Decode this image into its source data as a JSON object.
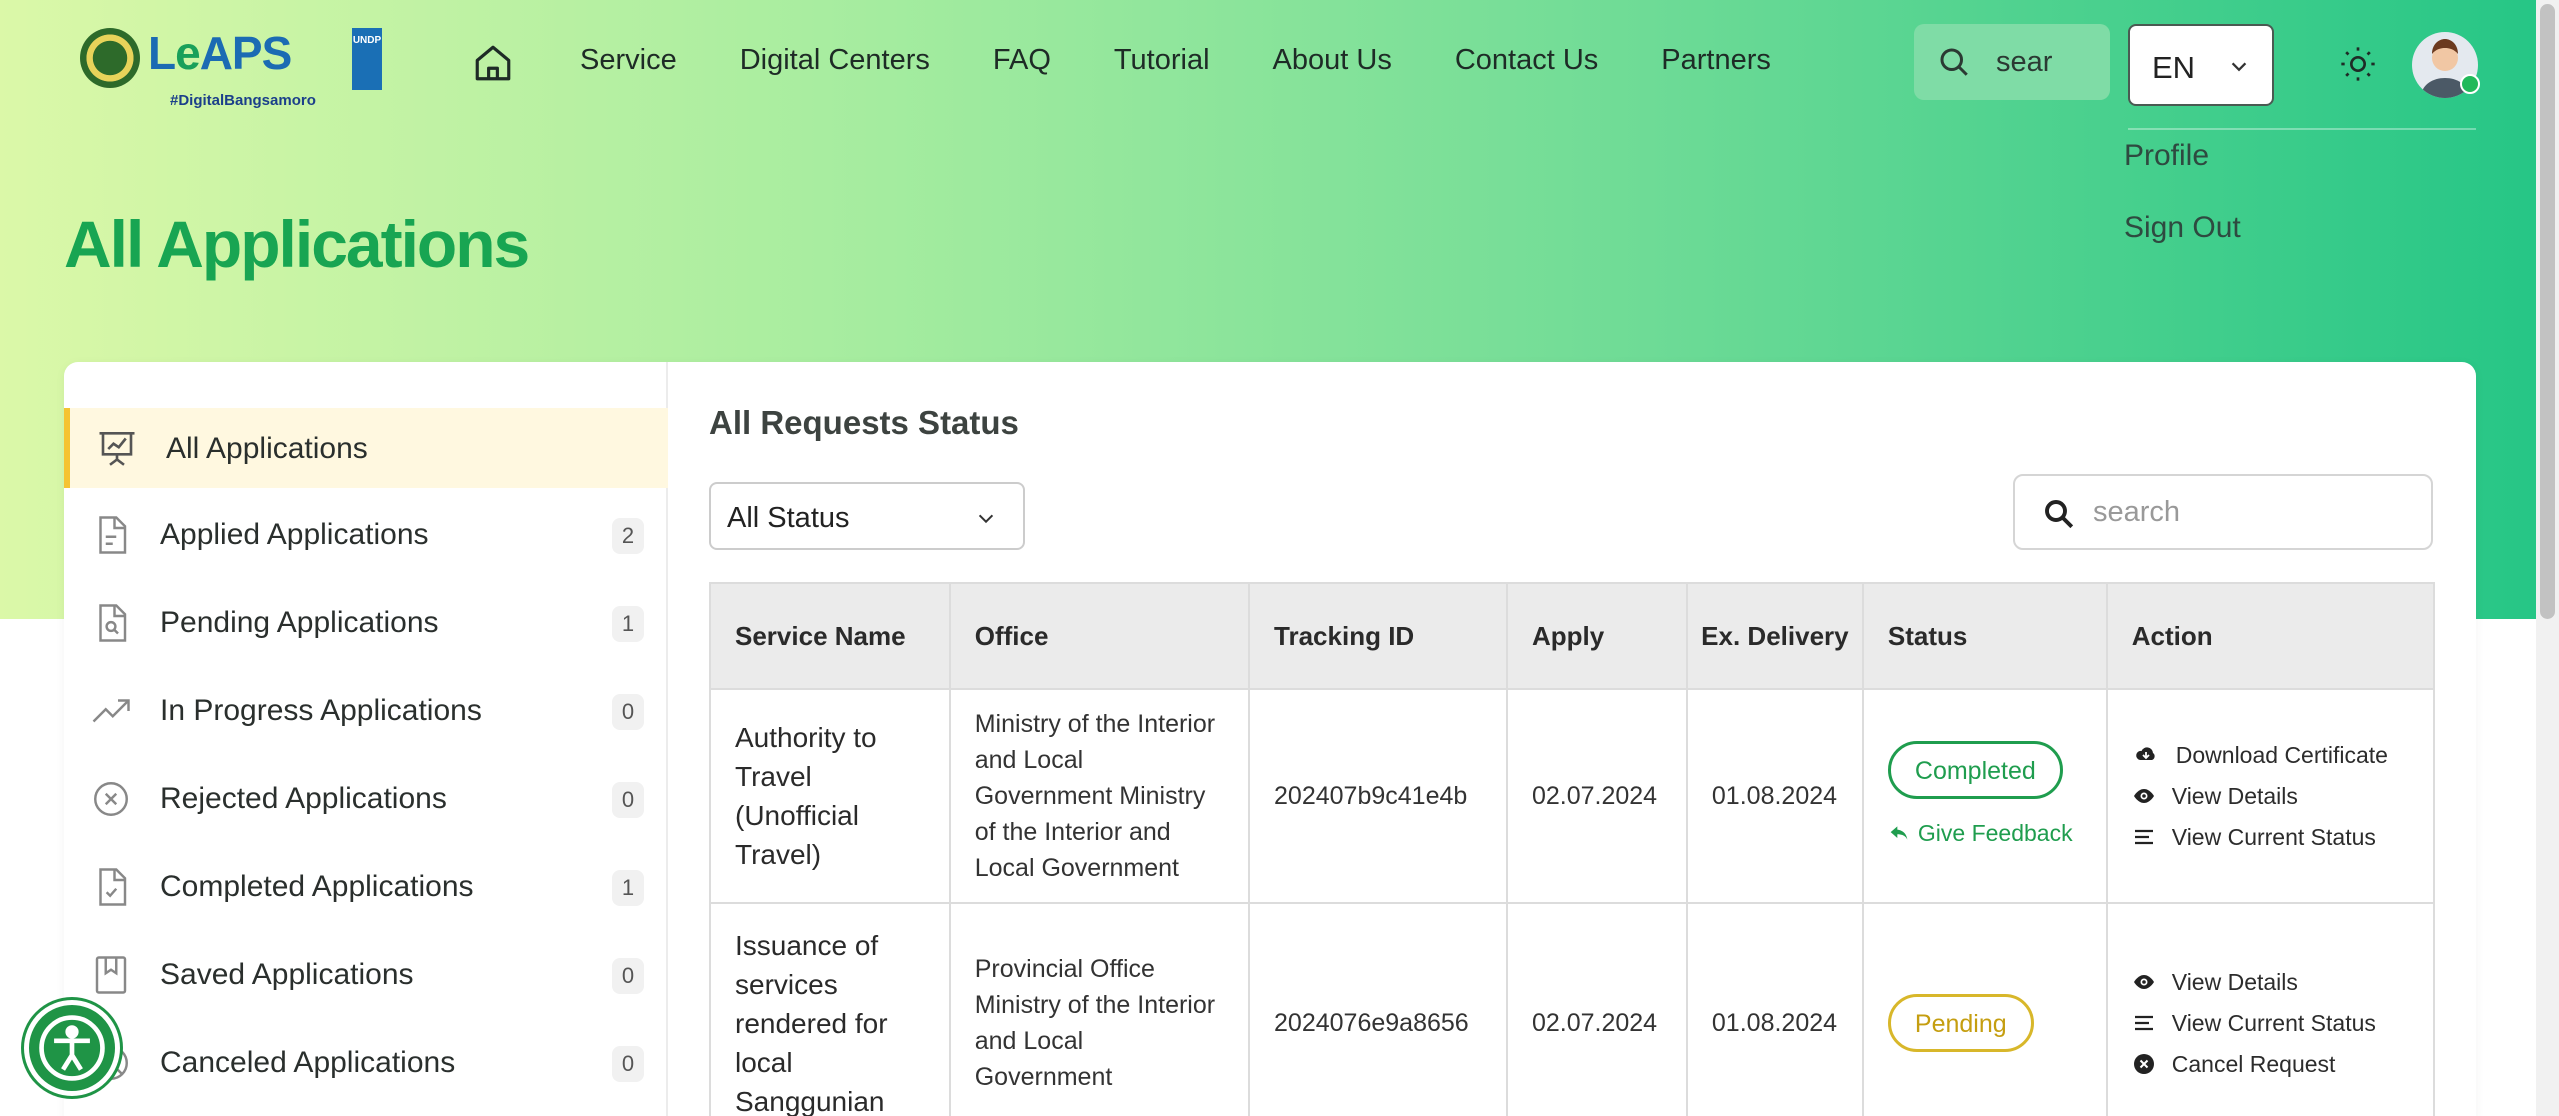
{
  "header": {
    "logo": {
      "brand_pre": "L",
      "brand_mid": "e",
      "brand_post": "APS",
      "tagline": "#DigitalBangsamoro",
      "undp": "UNDP"
    },
    "nav": [
      "Service",
      "Digital Centers",
      "FAQ",
      "Tutorial",
      "About Us",
      "Contact Us",
      "Partners"
    ],
    "search_placeholder": "sear",
    "language": "EN"
  },
  "user_menu": [
    "Profile",
    "Sign Out"
  ],
  "page_title": "All Applications",
  "sidebar": [
    {
      "label": "All Applications",
      "count": "",
      "icon": "presentation-chart-icon"
    },
    {
      "label": "Applied Applications",
      "count": "2",
      "icon": "document-icon"
    },
    {
      "label": "Pending Applications",
      "count": "1",
      "icon": "document-search-icon"
    },
    {
      "label": "In Progress Applications",
      "count": "0",
      "icon": "trending-up-icon"
    },
    {
      "label": "Rejected Applications",
      "count": "0",
      "icon": "x-circle-icon"
    },
    {
      "label": "Completed Applications",
      "count": "1",
      "icon": "document-check-icon"
    },
    {
      "label": "Saved Applications",
      "count": "0",
      "icon": "bookmark-icon"
    },
    {
      "label": "Canceled Applications",
      "count": "0",
      "icon": "cancel-icon"
    }
  ],
  "main": {
    "title": "All Requests Status",
    "status_filter": "All Status",
    "search_placeholder": "search",
    "columns": [
      "Service Name",
      "Office",
      "Tracking ID",
      "Apply",
      "Ex. Delivery",
      "Status",
      "Action"
    ],
    "rows": [
      {
        "service": "Authority to Travel (Unofficial Travel)",
        "office": "Ministry of the Interior and Local Government Ministry of the Interior and Local Government",
        "tracking_id": "202407b9c41e4b",
        "apply": "02.07.2024",
        "delivery": "01.08.2024",
        "status": "Completed",
        "feedback": "Give Feedback",
        "actions": [
          "Download Certificate",
          "View Details",
          "View Current Status"
        ]
      },
      {
        "service": "Issuance of services rendered for local Sanggunian",
        "office": "Provincial Office Ministry of the Interior and Local Government",
        "tracking_id": "2024076e9a8656",
        "apply": "02.07.2024",
        "delivery": "01.08.2024",
        "status": "Pending",
        "feedback": "",
        "actions": [
          "View Details",
          "View Current Status",
          "Cancel Request"
        ]
      }
    ]
  },
  "colors": {
    "primary": "#18a552",
    "pending": "#d8b72a",
    "active_border": "#f5c332"
  }
}
